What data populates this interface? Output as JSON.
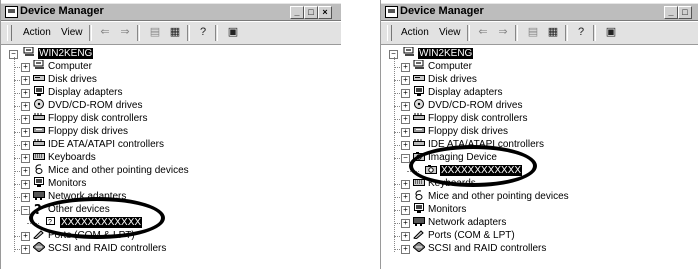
{
  "windows": [
    {
      "title": "Device Manager",
      "menu": {
        "action": "Action",
        "view": "View"
      },
      "window_buttons": [
        "_",
        "□",
        "×"
      ],
      "root": "WIN2KENG",
      "items": [
        {
          "label": "Computer",
          "icon": "computer-icon"
        },
        {
          "label": "Disk drives",
          "icon": "disk-drive-icon"
        },
        {
          "label": "Display adapters",
          "icon": "monitor-icon"
        },
        {
          "label": "DVD/CD-ROM drives",
          "icon": "cdrom-icon"
        },
        {
          "label": "Floppy disk controllers",
          "icon": "controller-icon"
        },
        {
          "label": "Floppy disk drives",
          "icon": "floppy-icon"
        },
        {
          "label": "IDE ATA/ATAPI controllers",
          "icon": "controller-icon"
        },
        {
          "label": "Keyboards",
          "icon": "keyboard-icon"
        },
        {
          "label": "Mice and other pointing devices",
          "icon": "mouse-icon"
        },
        {
          "label": "Monitors",
          "icon": "monitor-icon"
        },
        {
          "label": "Network adapters",
          "icon": "network-icon"
        },
        {
          "label": "Other devices",
          "icon": "question-icon",
          "expanded": true,
          "children": [
            {
              "label": "XXXXXXXXXXXX",
              "icon": "unknown-device-icon"
            }
          ]
        },
        {
          "label": "Ports (COM & LPT)",
          "icon": "port-icon"
        },
        {
          "label": "SCSI and RAID controllers",
          "icon": "scsi-icon"
        }
      ]
    },
    {
      "title": "Device Manager",
      "menu": {
        "action": "Action",
        "view": "View"
      },
      "window_buttons": [
        "_",
        "□"
      ],
      "root": "WIN2KENG",
      "items": [
        {
          "label": "Computer",
          "icon": "computer-icon"
        },
        {
          "label": "Disk drives",
          "icon": "disk-drive-icon"
        },
        {
          "label": "Display adapters",
          "icon": "monitor-icon"
        },
        {
          "label": "DVD/CD-ROM drives",
          "icon": "cdrom-icon"
        },
        {
          "label": "Floppy disk controllers",
          "icon": "controller-icon"
        },
        {
          "label": "Floppy disk drives",
          "icon": "floppy-icon"
        },
        {
          "label": "IDE ATA/ATAPI controllers",
          "icon": "controller-icon"
        },
        {
          "label": "Imaging Device",
          "icon": "camera-icon",
          "expanded": true,
          "children": [
            {
              "label": "XXXXXXXXXXXX",
              "icon": "camera-icon"
            }
          ]
        },
        {
          "label": "Keyboards",
          "icon": "keyboard-icon"
        },
        {
          "label": "Mice and other pointing devices",
          "icon": "mouse-icon"
        },
        {
          "label": "Monitors",
          "icon": "monitor-icon"
        },
        {
          "label": "Network adapters",
          "icon": "network-icon"
        },
        {
          "label": "Ports (COM & LPT)",
          "icon": "port-icon"
        },
        {
          "label": "SCSI and RAID controllers",
          "icon": "scsi-icon"
        }
      ]
    }
  ]
}
